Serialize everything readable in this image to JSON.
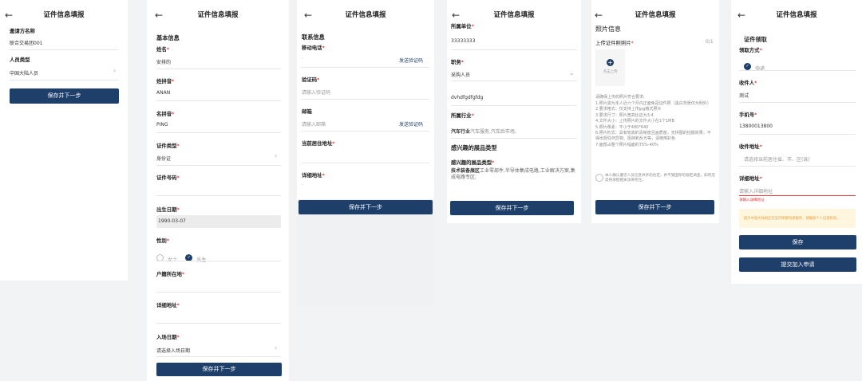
{
  "screen1": {
    "title": "证件信息填报",
    "inviter_label": "邀请方名称",
    "inviter_value": "联合交易团001",
    "persontype_label": "人员类型",
    "persontype_value": "中国大陆人员",
    "save_next": "保存并下一步"
  },
  "screen2": {
    "title": "证件信息填报",
    "section_basic": "基本信息",
    "name_label": "姓名",
    "name_value": "安排的",
    "surname_py_label": "姓拼音",
    "surname_py_value": "ANAN",
    "given_py_label": "名拼音",
    "given_py_value": "PING",
    "idtype_label": "证件类型",
    "idtype_value": "身份证",
    "idno_label": "证件号码",
    "birth_label": "出生日期",
    "birth_value": "1990-03-07",
    "gender_label": "性别",
    "gender_female": "女士",
    "gender_male": "先生",
    "hukou_label": "户籍所在地",
    "addr_label": "详细地址",
    "entry_label": "入场日期",
    "entry_placeholder": "请选择入场日期",
    "save_next": "保存并下一步"
  },
  "screen3": {
    "title": "证件信息填报",
    "section": "联系信息",
    "phone_label": "移动电话",
    "send_code": "发送验证码",
    "code_label": "验证码",
    "code_placeholder": "请输入验证码",
    "email_label": "邮箱",
    "email_placeholder": "请输入邮箱",
    "send_code2": "发送验证码",
    "current_addr_label": "当前居住地址",
    "detail_addr_label": "详细地址",
    "save_next": "保存并下一步"
  },
  "screen4": {
    "title": "证件信息填报",
    "company_label": "所属单位",
    "company_value": "33333333",
    "position_label": "职务",
    "position_value": "采购人员",
    "other_value": "dvhdfgdfgfdg",
    "industry_label": "所属行业",
    "industry_value_bold": "汽车行业",
    "industry_value_rest": "汽车服务,汽车后市场,",
    "interest_section": "感兴趣的展品类型",
    "interest_label": "感兴趣的展品类型",
    "interest_value_bold": "技术装备展区",
    "interest_value_rest": "工业零部件,半导体集成电路,工业解决方案,集成电路专区,",
    "save_next": "保存并下一步"
  },
  "screen5": {
    "title": "证件信息填报",
    "section": "照片信息",
    "upload_label": "上传证件照照片",
    "upload_count": "0/1",
    "upload_text": "点击上传",
    "req_title": "请确保上传的照片符合要求:",
    "reqs": [
      "1.照片需为本人近六个月内正面免冠证件照（黑白背景仅为例外）",
      "2.要求格式：仅支持上传jpg格式照片",
      "3.要求尺寸：照片宽高比应为3:4",
      "4.文件大小：上传照片的文件大小在1个1MB",
      "5.照片像素：不小于480*640",
      "6.照片形式：具有较高的清晰度且画质度，无拼图的拍摄效果，不",
      "得出现任何异物、阻挡和反光等，请使用彩色",
      "7.面部占整个照片幅面的75%-40%"
    ],
    "agree_text": "本人确认遵守人员信息共享的约定，并不受国际的规定调查，如有违反将承担相关法律责任。",
    "save_next": "保存并下一步"
  },
  "screen6": {
    "title": "证件信息填报",
    "section": "证件领取",
    "method_label": "领取方式",
    "method_value": "快递",
    "recipient_label": "收件人",
    "recipient_value": "测试",
    "phone_label": "手机号",
    "phone_value": "13800013800",
    "addr_label": "收件地址",
    "addr_placeholder": "请选择当前居住省、市、区(县)",
    "detail_label": "详细地址",
    "detail_placeholder": "请输入详细地址",
    "detail_error": "请输入详细地址",
    "notice": "提示中国大陆地区仅支持邮寄快递服务，请确保个人信息有效。",
    "save": "保存",
    "submit": "提交加入申请"
  }
}
